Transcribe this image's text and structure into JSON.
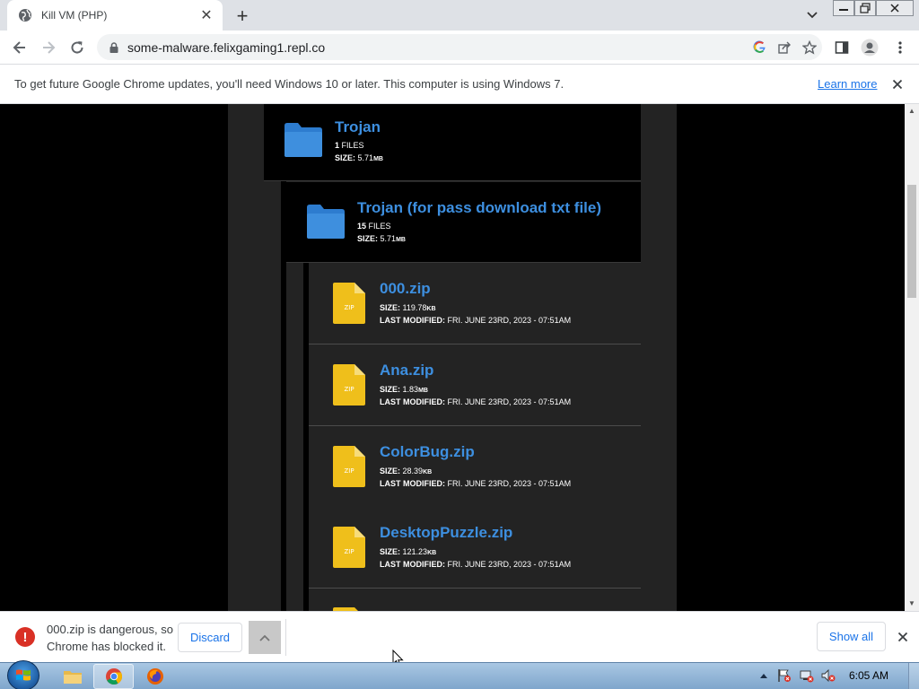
{
  "browser": {
    "tab_title": "Kill VM (PHP)",
    "url": "some-malware.felixgaming1.repl.co"
  },
  "infobar": {
    "message": "To get future Google Chrome updates, you'll need Windows 10 or later. This computer is using Windows 7.",
    "learn_more": "Learn more"
  },
  "listing": {
    "folders": [
      {
        "name": "Trojan",
        "files_count": "1",
        "files_label": "FILES",
        "size_label": "SIZE:",
        "size": "5.71",
        "size_unit": "MB"
      },
      {
        "name": "Trojan (for pass download txt file)",
        "files_count": "15",
        "files_label": "FILES",
        "size_label": "SIZE:",
        "size": "5.71",
        "size_unit": "MB"
      }
    ],
    "zip_badge": "ZIP",
    "size_label": "SIZE:",
    "modified_label": "LAST MODIFIED:",
    "files": [
      {
        "name": "000.zip",
        "size": "119.78",
        "size_unit": "KB",
        "modified": "FRI. JUNE 23RD, 2023 - 07:51AM"
      },
      {
        "name": "Ana.zip",
        "size": "1.83",
        "size_unit": "MB",
        "modified": "FRI. JUNE 23RD, 2023 - 07:51AM"
      },
      {
        "name": "ColorBug.zip",
        "size": "28.39",
        "size_unit": "KB",
        "modified": "FRI. JUNE 23RD, 2023 - 07:51AM"
      },
      {
        "name": "DesktopPuzzle.zip",
        "size": "121.23",
        "size_unit": "KB",
        "modified": "FRI. JUNE 23RD, 2023 - 07:51AM"
      }
    ]
  },
  "download_bar": {
    "warning_line1": "000.zip is dangerous, so",
    "warning_line2": "Chrome has blocked it.",
    "discard": "Discard",
    "show_all": "Show all"
  },
  "taskbar": {
    "time": "6:05 AM"
  },
  "colors": {
    "link_blue": "#3d8fe0",
    "folder_blue": "#3e8fde",
    "zip_yellow": "#efbf1b",
    "danger_red": "#d93025"
  }
}
